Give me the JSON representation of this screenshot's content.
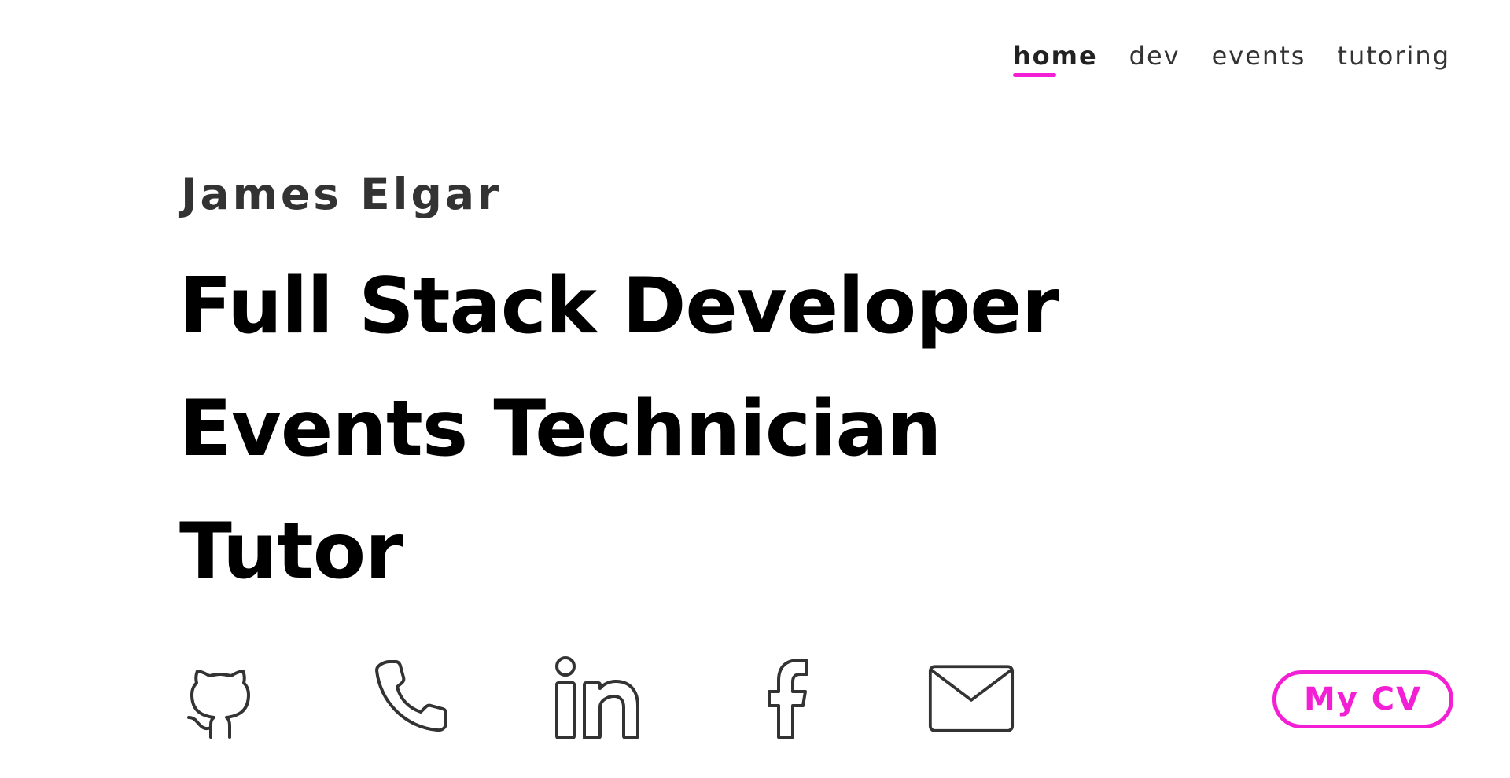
{
  "nav": {
    "items": [
      {
        "label": "home",
        "active": true
      },
      {
        "label": "dev",
        "active": false
      },
      {
        "label": "events",
        "active": false
      },
      {
        "label": "tutoring",
        "active": false
      }
    ]
  },
  "hero": {
    "name": "James Elgar",
    "roles": [
      "Full Stack Developer",
      "Events Technician",
      "Tutor"
    ]
  },
  "socials": [
    {
      "icon": "github-icon"
    },
    {
      "icon": "phone-icon"
    },
    {
      "icon": "linkedin-icon"
    },
    {
      "icon": "facebook-icon"
    },
    {
      "icon": "mail-icon"
    }
  ],
  "cv_button": {
    "label": "My CV"
  },
  "colors": {
    "accent": "#f21fd4",
    "text_dark": "#333333",
    "heading": "#000000",
    "background": "#ffffff"
  }
}
